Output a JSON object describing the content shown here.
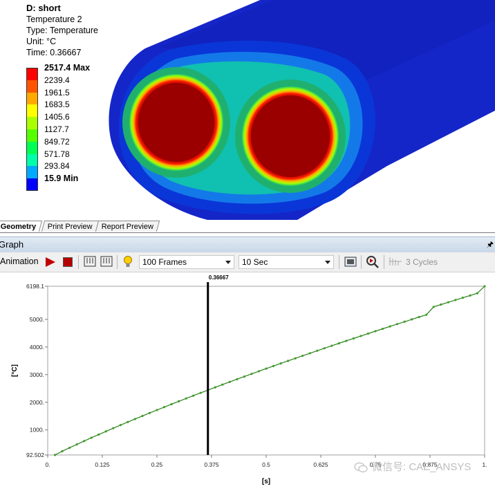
{
  "viewport": {
    "result_name": "D: short",
    "result_type": "Temperature 2",
    "type_line": "Type: Temperature",
    "unit_line": "Unit: °C",
    "time_line": "Time: 0.36667",
    "legend": [
      {
        "label": "2517.4 Max",
        "color": "#ff0000",
        "bold": true
      },
      {
        "label": "2239.4",
        "color": "#ff5500",
        "bold": false
      },
      {
        "label": "1961.5",
        "color": "#ffaa00",
        "bold": false
      },
      {
        "label": "1683.5",
        "color": "#ffff00",
        "bold": false
      },
      {
        "label": "1405.6",
        "color": "#aaff00",
        "bold": false
      },
      {
        "label": "1127.7",
        "color": "#55ff00",
        "bold": false
      },
      {
        "label": "849.72",
        "color": "#00ff55",
        "bold": false
      },
      {
        "label": "571.78",
        "color": "#00ffaa",
        "bold": false
      },
      {
        "label": "293.84",
        "color": "#00aaff",
        "bold": false
      },
      {
        "label": "15.9 Min",
        "color": "#0000ff",
        "bold": true
      }
    ]
  },
  "tabs": [
    {
      "label": "Geometry",
      "active": true
    },
    {
      "label": "Print Preview",
      "active": false
    },
    {
      "label": "Report Preview",
      "active": false
    }
  ],
  "graph": {
    "title": "Graph",
    "pin_icon": "pin-icon"
  },
  "toolbar": {
    "animation_label": "Animation",
    "frames_value": "100 Frames",
    "duration_value": "10 Sec",
    "cycles_label": "3 Cycles"
  },
  "watermark": "微信号: CAE_ANSYS",
  "colors": {
    "line": "#2e7d1f",
    "marker": "#3aa020",
    "cursor": "#000000",
    "header_bg": "#d5e0ee"
  },
  "chart_data": {
    "type": "line",
    "xlabel": "[s]",
    "ylabel": "[°C]",
    "xlim": [
      0,
      1
    ],
    "ylim": [
      92.502,
      6198.1
    ],
    "x_ticks": [
      "0.",
      "0.125",
      "0.25",
      "0.375",
      "0.5",
      "0.625",
      "0.75",
      "0.875",
      "1."
    ],
    "x_tick_values": [
      0,
      0.125,
      0.25,
      0.375,
      0.5,
      0.625,
      0.75,
      0.875,
      1.0
    ],
    "y_ticks": [
      "92.502",
      "1000.",
      "2000.",
      "3000.",
      "4000.",
      "5000.",
      "6198.1"
    ],
    "y_tick_values": [
      92.502,
      1000,
      2000,
      3000,
      4000,
      5000,
      6198.1
    ],
    "cursor_x": 0.36667,
    "cursor_label": "0.36667",
    "series": [
      {
        "x": [
          0.0167,
          0.0333,
          0.05,
          0.0667,
          0.0833,
          0.1,
          0.1167,
          0.1333,
          0.15,
          0.1667,
          0.1833,
          0.2,
          0.2167,
          0.2333,
          0.25,
          0.2667,
          0.2833,
          0.3,
          0.3167,
          0.3333,
          0.35,
          0.3667,
          0.3833,
          0.4,
          0.4167,
          0.4333,
          0.45,
          0.4667,
          0.4833,
          0.5,
          0.5167,
          0.5333,
          0.55,
          0.5667,
          0.5833,
          0.6,
          0.6167,
          0.6333,
          0.65,
          0.6667,
          0.6833,
          0.7,
          0.7167,
          0.7333,
          0.75,
          0.7667,
          0.7833,
          0.8,
          0.8167,
          0.8333,
          0.85,
          0.8667,
          0.8833,
          0.9,
          0.9167,
          0.9333,
          0.95,
          0.9667,
          0.9833,
          1.0
        ],
        "values": [
          92.5,
          227,
          352,
          475,
          596,
          715,
          832,
          947,
          1061,
          1174,
          1285,
          1395,
          1504,
          1612,
          1719,
          1825,
          1930,
          2034,
          2137,
          2239,
          2340,
          2440,
          2540,
          2639,
          2737,
          2834,
          2931,
          3027,
          3122,
          3217,
          3311,
          3405,
          3498,
          3590,
          3682,
          3773,
          3864,
          3954,
          4044,
          4133,
          4222,
          4310,
          4398,
          4485,
          4572,
          4658,
          4744,
          4830,
          4915,
          5000,
          5084,
          5168,
          5452,
          5535,
          5618,
          5700,
          5782,
          5864,
          5945,
          6198.1
        ]
      }
    ]
  }
}
